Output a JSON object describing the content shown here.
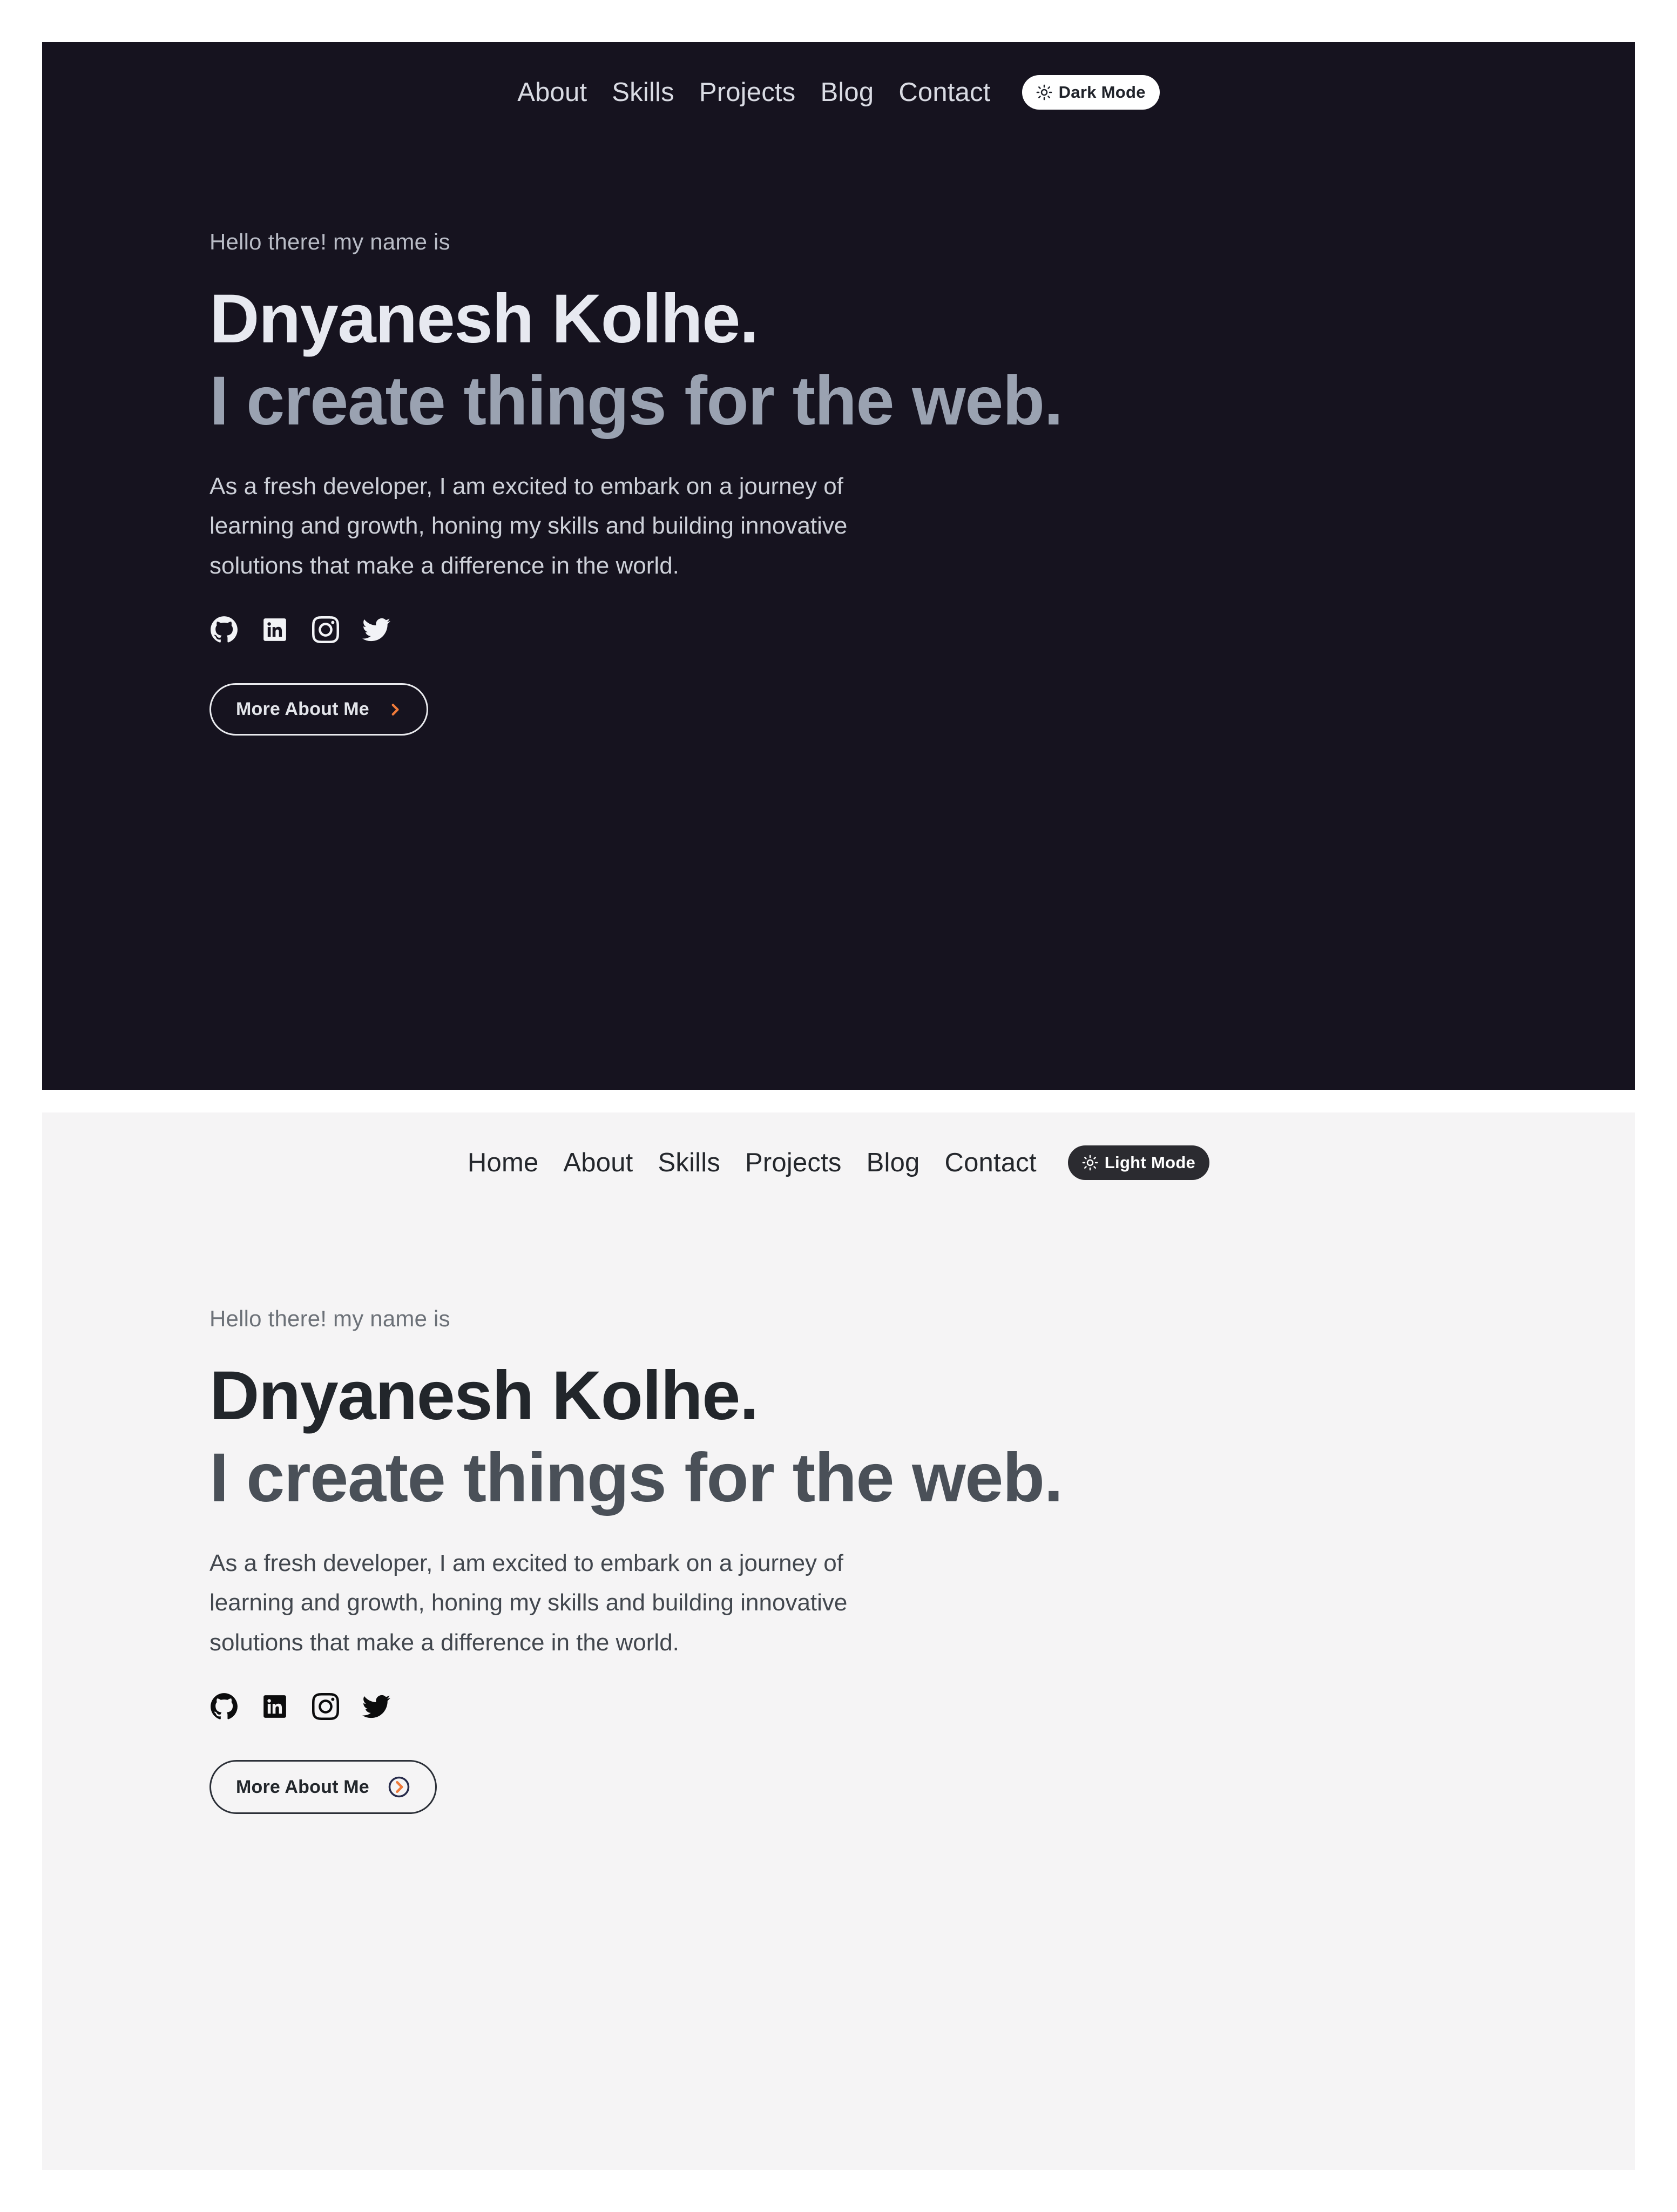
{
  "meta": {
    "accent_orange": "#ef7a3a",
    "dark_bg": "#16131f",
    "light_bg": "#f5f4f5",
    "page_bg": "#ffffff"
  },
  "dark_section": {
    "nav": {
      "links": [
        {
          "label": "About"
        },
        {
          "label": "Skills"
        },
        {
          "label": "Projects"
        },
        {
          "label": "Blog"
        },
        {
          "label": "Contact"
        }
      ],
      "theme_toggle": {
        "label": "Dark Mode",
        "icon": "sun-icon"
      }
    },
    "hero": {
      "greeting": "Hello there! my name is",
      "headline_line1": "Dnyanesh Kolhe.",
      "headline_line2": "I create things for the web.",
      "bio_line1": "As a fresh developer, I am excited to embark on a journey of",
      "bio_line2": "learning and growth, honing my skills and building innovative",
      "bio_line3": "solutions that make a difference in the world.",
      "socials": [
        {
          "name": "github-icon"
        },
        {
          "name": "linkedin-icon"
        },
        {
          "name": "instagram-icon"
        },
        {
          "name": "twitter-icon"
        }
      ],
      "cta_label": "More About Me",
      "cta_icon": "chevron-right-icon"
    }
  },
  "light_section": {
    "nav": {
      "links": [
        {
          "label": "Home"
        },
        {
          "label": "About"
        },
        {
          "label": "Skills"
        },
        {
          "label": "Projects"
        },
        {
          "label": "Blog"
        },
        {
          "label": "Contact"
        }
      ],
      "theme_toggle": {
        "label": "Light Mode",
        "icon": "sun-icon"
      }
    },
    "hero": {
      "greeting": "Hello there! my name is",
      "headline_line1": "Dnyanesh Kolhe.",
      "headline_line2": "I create things for the web.",
      "bio_line1": "As a fresh developer, I am excited to embark on a journey of",
      "bio_line2": "learning and growth, honing my skills and building innovative",
      "bio_line3": "solutions that make a difference in the world.",
      "socials": [
        {
          "name": "github-icon"
        },
        {
          "name": "linkedin-icon"
        },
        {
          "name": "instagram-icon"
        },
        {
          "name": "twitter-icon"
        }
      ],
      "cta_label": "More About Me",
      "cta_icon": "chevron-right-circle-icon"
    }
  }
}
